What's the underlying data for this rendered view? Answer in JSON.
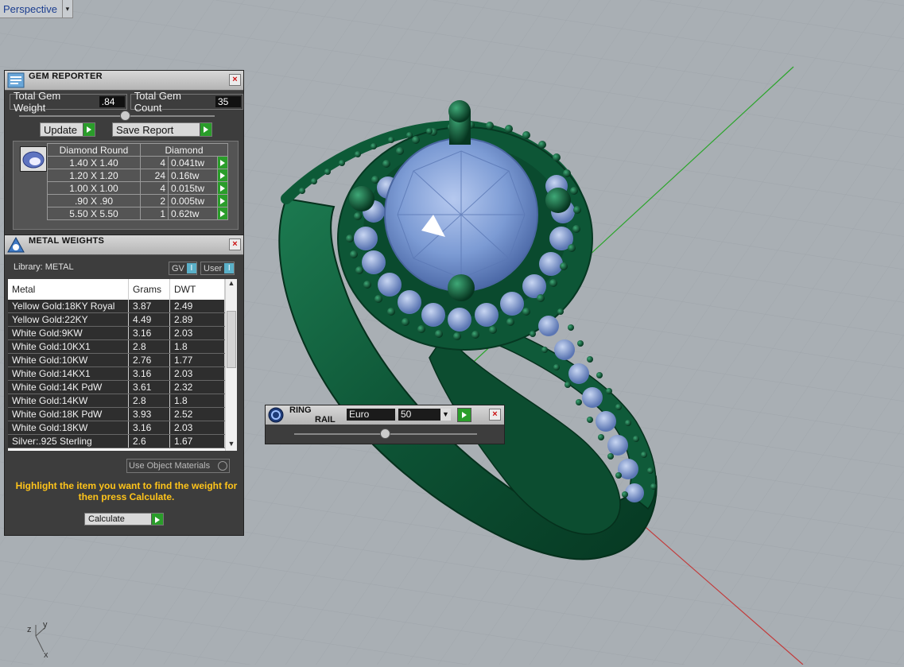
{
  "viewport": {
    "label": "Perspective",
    "axes": {
      "x": "x",
      "y": "y",
      "z": "z"
    }
  },
  "gem_reporter": {
    "title": "GEM REPORTER",
    "total_weight_label": "Total Gem Weight",
    "total_weight_value": ".84",
    "total_count_label": "Total Gem Count",
    "total_count_value": "35",
    "update_label": "Update",
    "save_report_label": "Save Report",
    "header_shape": "Diamond Round",
    "header_material": "Diamond",
    "rows": [
      {
        "size": "1.40 X 1.40",
        "count": "4",
        "weight": "0.041tw"
      },
      {
        "size": "1.20 X 1.20",
        "count": "24",
        "weight": "0.16tw"
      },
      {
        "size": "1.00 X 1.00",
        "count": "4",
        "weight": "0.015tw"
      },
      {
        "size": ".90 X .90",
        "count": "2",
        "weight": "0.005tw"
      },
      {
        "size": "5.50 X 5.50",
        "count": "1",
        "weight": "0.62tw"
      }
    ]
  },
  "metal_weights": {
    "title": "METAL WEIGHTS",
    "library_label": "Library: METAL",
    "gv_label": "GV",
    "user_label": "User",
    "columns": [
      "Metal",
      "Grams",
      "DWT"
    ],
    "rows": [
      {
        "metal": "Yellow Gold:18KY Royal",
        "grams": "3.87",
        "dwt": "2.49"
      },
      {
        "metal": "Yellow Gold:22KY",
        "grams": "4.49",
        "dwt": "2.89"
      },
      {
        "metal": "White Gold:9KW",
        "grams": "3.16",
        "dwt": "2.03"
      },
      {
        "metal": "White Gold:10KX1",
        "grams": "2.8",
        "dwt": "1.8"
      },
      {
        "metal": "White Gold:10KW",
        "grams": "2.76",
        "dwt": "1.77"
      },
      {
        "metal": "White Gold:14KX1",
        "grams": "3.16",
        "dwt": "2.03"
      },
      {
        "metal": "White Gold:14K PdW",
        "grams": "3.61",
        "dwt": "2.32"
      },
      {
        "metal": "White Gold:14KW",
        "grams": "2.8",
        "dwt": "1.8"
      },
      {
        "metal": "White Gold:18K PdW",
        "grams": "3.93",
        "dwt": "2.52"
      },
      {
        "metal": "White Gold:18KW",
        "grams": "3.16",
        "dwt": "2.03"
      },
      {
        "metal": "Silver:.925 Sterling",
        "grams": "2.6",
        "dwt": "1.67"
      }
    ],
    "use_object_materials_label": "Use Object Materials",
    "hint": "Highlight the item you want to find the weight for then press Calculate.",
    "calculate_label": "Calculate"
  },
  "ring_rail": {
    "title_line1": "RING",
    "title_line2": "RAIL",
    "standard_value": "Euro",
    "size_value": "50"
  },
  "colors": {
    "metal": "#0e5a3a",
    "gem": "#7e9ed6",
    "viewport_bg": "#a9afb4",
    "panel_bg": "#3d3d3d",
    "accent_go": "#2a9d2a",
    "hint_text": "#ffc41a"
  }
}
